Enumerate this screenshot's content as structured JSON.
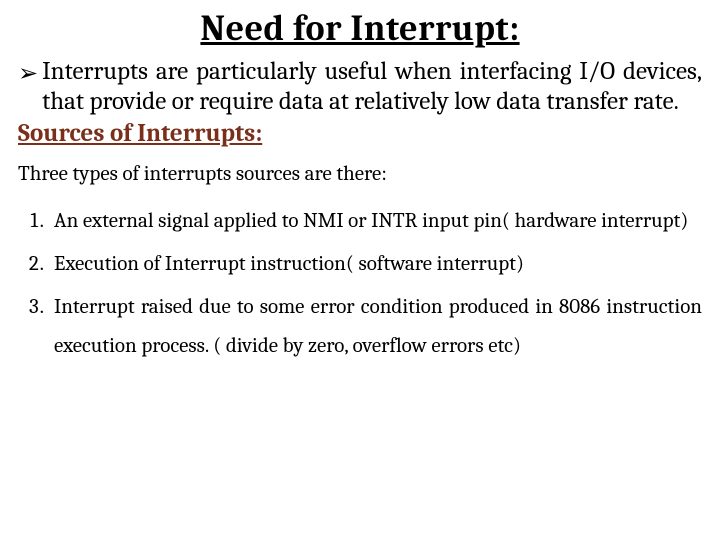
{
  "title": "Need for Interrupt:",
  "bullet_glyph": "➢",
  "bullet_text": "Interrupts are particularly useful when interfacing I/O devices, that provide or require data at relatively low data transfer rate.",
  "subheading": "Sources of Interrupts:",
  "intro": "Three types of interrupts sources are there:",
  "items": [
    "An external signal applied to NMI or INTR input pin( hardware interrupt)",
    "Execution of Interrupt instruction( software interrupt)",
    "Interrupt raised due to some error condition produced in 8086 instruction execution process. ( divide by zero, overflow errors etc)"
  ]
}
